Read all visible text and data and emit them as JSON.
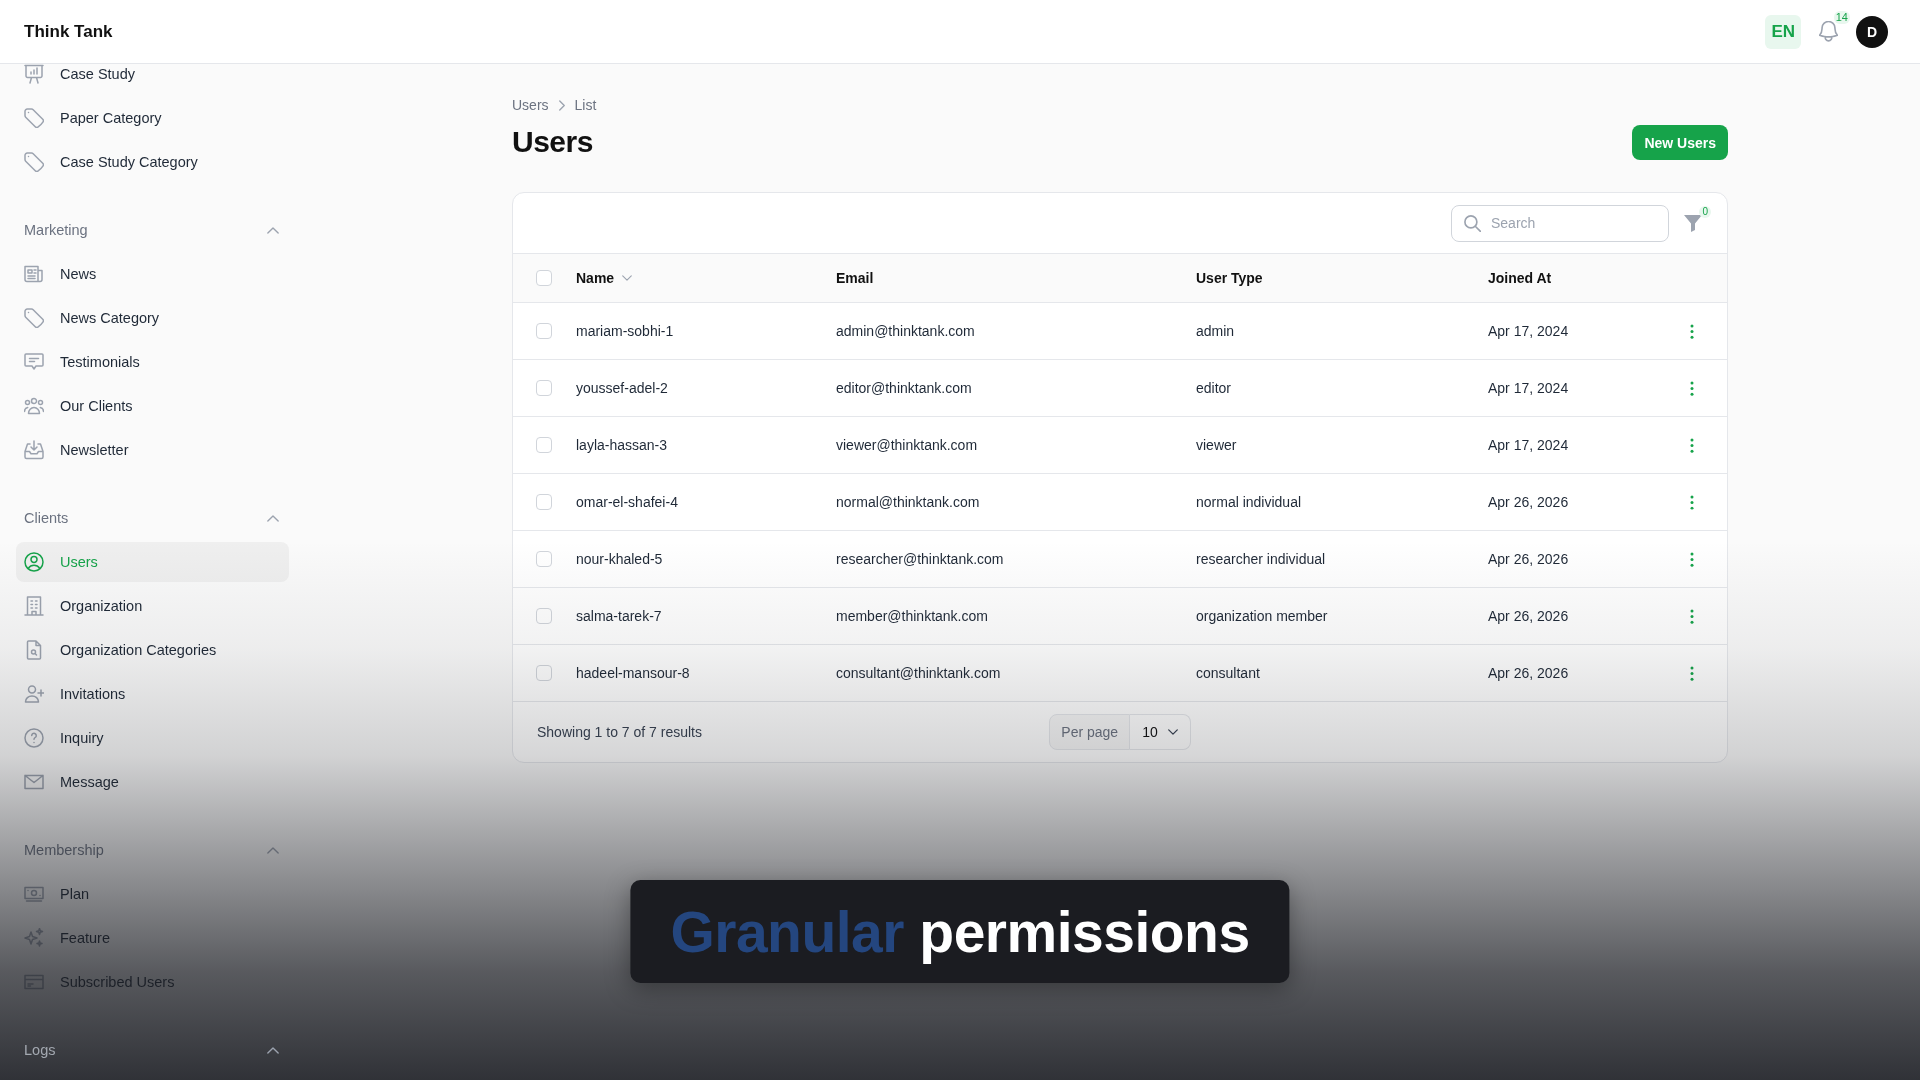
{
  "header": {
    "title": "Think Tank",
    "language": "EN",
    "notifications": "14",
    "avatar": "D"
  },
  "sidebar": {
    "groups": [
      {
        "items": [
          {
            "label": "Case Study",
            "selected": false
          },
          {
            "label": "Paper Category",
            "selected": false
          },
          {
            "label": "Case Study Category",
            "selected": false
          }
        ]
      },
      {
        "label": "Marketing",
        "expanded": true,
        "items": [
          {
            "label": "News",
            "selected": false
          },
          {
            "label": "News Category",
            "selected": false
          },
          {
            "label": "Testimonials",
            "selected": false
          },
          {
            "label": "Our Clients",
            "selected": false
          },
          {
            "label": "Newsletter",
            "selected": false
          }
        ]
      },
      {
        "label": "Clients",
        "expanded": true,
        "items": [
          {
            "label": "Users",
            "selected": true
          },
          {
            "label": "Organization",
            "selected": false
          },
          {
            "label": "Organization Categories",
            "selected": false
          },
          {
            "label": "Invitations",
            "selected": false
          },
          {
            "label": "Inquiry",
            "selected": false
          },
          {
            "label": "Message",
            "selected": false
          }
        ]
      },
      {
        "label": "Membership",
        "expanded": true,
        "items": [
          {
            "label": "Plan",
            "selected": false
          },
          {
            "label": "Feature",
            "selected": false
          },
          {
            "label": "Subscribed Users",
            "selected": false
          }
        ]
      },
      {
        "label": "Logs",
        "expanded": true
      }
    ]
  },
  "page": {
    "breadcrumbs": [
      "Users",
      "List"
    ],
    "title": "Users",
    "primary_button": "New Users"
  },
  "table": {
    "search": {
      "placeholder": "Search"
    },
    "filter_count": "0",
    "all_selected": false,
    "columns": [
      {
        "label": "Name",
        "sortable": true
      },
      {
        "label": "Email",
        "sortable": false
      },
      {
        "label": "User Type",
        "sortable": false
      },
      {
        "label": "Joined At",
        "sortable": false
      }
    ],
    "rows": [
      {
        "name": "mariam-sobhi-1",
        "email": "admin@thinktank.com",
        "user_type": "admin",
        "joined_at": "Apr 17, 2024",
        "selected": false
      },
      {
        "name": "youssef-adel-2",
        "email": "editor@thinktank.com",
        "user_type": "editor",
        "joined_at": "Apr 17, 2024",
        "selected": false
      },
      {
        "name": "layla-hassan-3",
        "email": "viewer@thinktank.com",
        "user_type": "viewer",
        "joined_at": "Apr 17, 2024",
        "selected": false
      },
      {
        "name": "omar-el-shafei-4",
        "email": "normal@thinktank.com",
        "user_type": "normal individual",
        "joined_at": "Apr 26, 2026",
        "selected": false
      },
      {
        "name": "nour-khaled-5",
        "email": "researcher@thinktank.com",
        "user_type": "researcher individual",
        "joined_at": "Apr 26, 2026",
        "selected": false
      },
      {
        "name": "salma-tarek-7",
        "email": "member@thinktank.com",
        "user_type": "organization member",
        "joined_at": "Apr 26, 2026",
        "selected": false
      },
      {
        "name": "hadeel-mansour-8",
        "email": "consultant@thinktank.com",
        "user_type": "consultant",
        "joined_at": "Apr 26, 2026",
        "selected": false
      }
    ],
    "footer": {
      "summary": "Showing 1 to 7 of 7 results",
      "per_page_label": "Per page",
      "per_page": "10"
    }
  },
  "caption": {
    "highlight": "Granular",
    "text": "permissions"
  }
}
